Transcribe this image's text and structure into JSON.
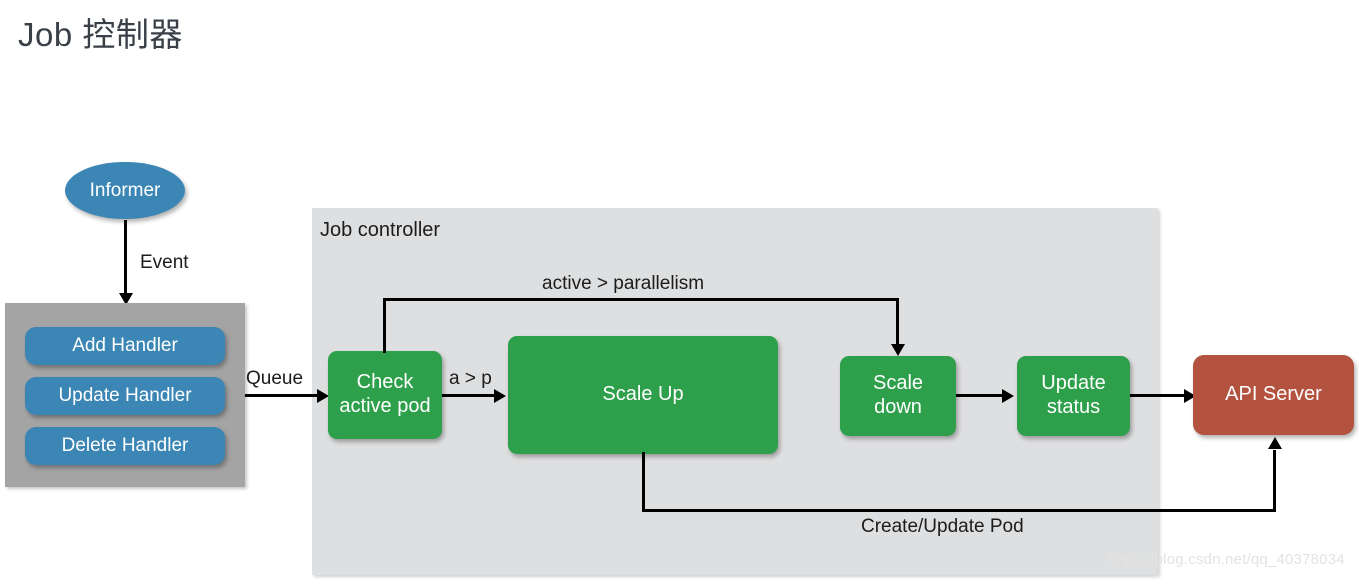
{
  "page": {
    "title": "Job 控制器",
    "watermark": "https://blog.csdn.net/qq_40378034"
  },
  "colors": {
    "background": "#ffffff",
    "title_text": "#3a4048",
    "controller_panel": "#dedfe0",
    "handler_panel": "#a4a4a4",
    "node_green": "#2ea04c",
    "node_blue": "#3b86b5",
    "node_red": "#b3523f",
    "connector": "#000000",
    "watermark_text": "#e3e3e3"
  },
  "informer": {
    "label": "Informer"
  },
  "handler_panel": {
    "items": [
      {
        "label": "Add Handler"
      },
      {
        "label": "Update Handler"
      },
      {
        "label": "Delete Handler"
      }
    ]
  },
  "controller": {
    "label": "Job controller",
    "nodes": [
      {
        "label": "Check\nactive pod",
        "line1": "Check",
        "line2": "active pod"
      },
      {
        "label": "Scale Up",
        "line1": "Scale Up",
        "line2": ""
      },
      {
        "label": "Scale\ndown",
        "line1": "Scale",
        "line2": "down"
      },
      {
        "label": "Update\nstatus",
        "line1": "Update",
        "line2": "status"
      }
    ]
  },
  "api_server": {
    "label": "API Server"
  },
  "edges": [
    {
      "id": "event",
      "label": "Event"
    },
    {
      "id": "queue",
      "label": "Queue"
    },
    {
      "id": "a-gt-p",
      "label": "a > p"
    },
    {
      "id": "active-gt-parallelism",
      "label": "active > parallelism"
    },
    {
      "id": "create-update-pod",
      "label": "Create/Update  Pod"
    }
  ]
}
